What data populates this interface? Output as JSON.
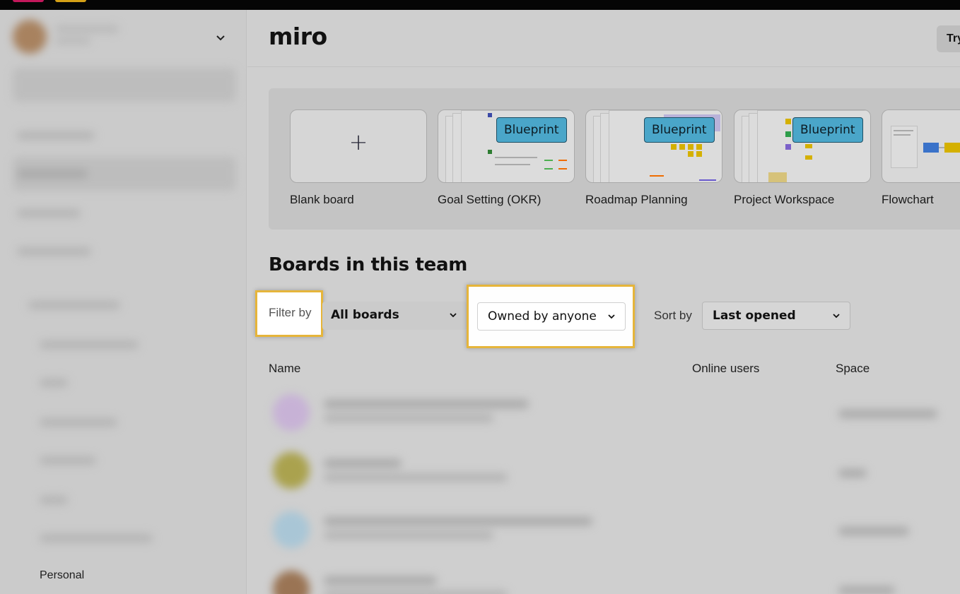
{
  "colors": {
    "highlight": "#e6b53a",
    "blueprint_badge": "#4aa6c9",
    "page_bg": "#cfcfcf"
  },
  "sidebar": {
    "personal_label": "Personal"
  },
  "header": {
    "logo_text": "miro",
    "try_button_label": "Try"
  },
  "templates": [
    {
      "label": "Blank board",
      "badge": "",
      "icon": "plus-icon"
    },
    {
      "label": "Goal Setting (OKR)",
      "badge": "Blueprint"
    },
    {
      "label": "Roadmap Planning",
      "badge": "Blueprint"
    },
    {
      "label": "Project Workspace",
      "badge": "Blueprint"
    },
    {
      "label": "Flowchart",
      "badge": ""
    }
  ],
  "boards_section": {
    "title": "Boards in this team",
    "filter_label": "Filter by",
    "filter_value": "All boards",
    "owner_value": "Owned by anyone",
    "sort_label": "Sort by",
    "sort_value": "Last opened"
  },
  "table": {
    "columns": [
      "Name",
      "Online users",
      "Space"
    ]
  }
}
